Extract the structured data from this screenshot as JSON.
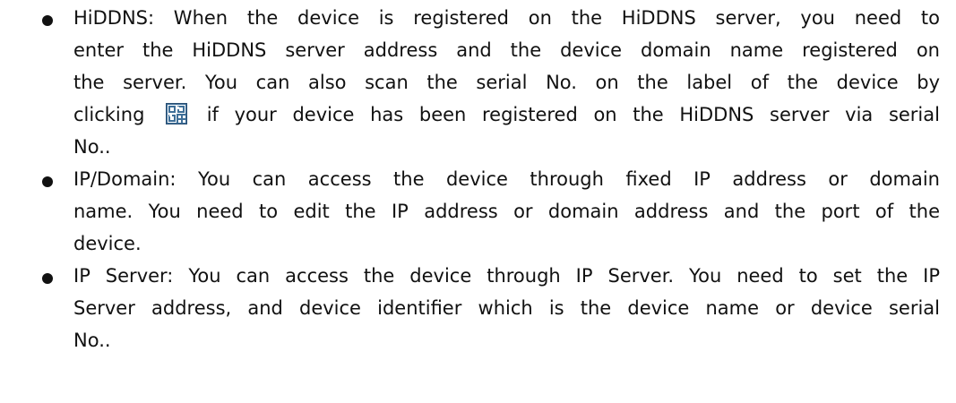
{
  "items": [
    {
      "id": "hiddns",
      "lines": [
        "HiDDNS: When the device is registered on the HiDDNS server, you need to",
        "enter the HiDDNS server address and the device domain name registered on",
        "the server. You can also scan the serial No. on the label of the device by"
      ],
      "line4_before_icon": "clicking",
      "line4_after_icon": "if your device has been registered on the HiDDNS server via serial",
      "line5": "No..",
      "icon": "qr-code-icon"
    },
    {
      "id": "ip-domain",
      "lines": [
        "IP/Domain: You can access the device through fixed IP address or domain",
        "name. You need to edit the IP address or domain address and the port of the",
        "device."
      ]
    },
    {
      "id": "ip-server",
      "lines": [
        "IP Server: You can access the device through IP Server. You need to set the IP",
        "Server address, and device identifier which is the device name or device serial",
        "No.."
      ]
    }
  ],
  "colors": {
    "text": "#111111",
    "icon_fill": "#3f6f98"
  }
}
